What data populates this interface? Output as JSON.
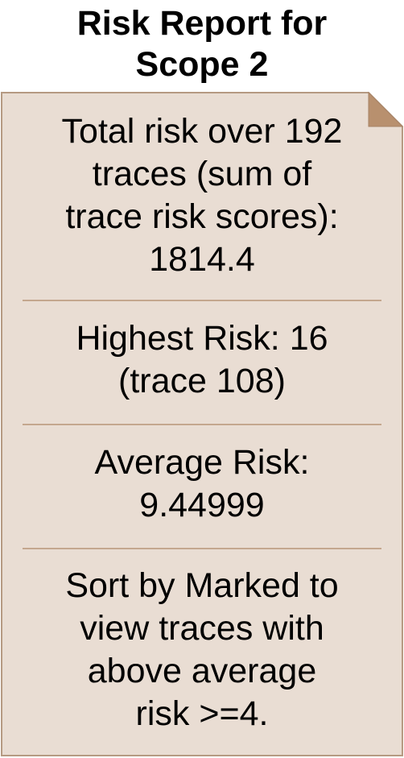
{
  "title": {
    "line1": "Risk Report for",
    "line2": "Scope 2"
  },
  "report": {
    "total": {
      "line1": "Total risk over 192",
      "line2": "traces (sum of",
      "line3": "trace risk scores):",
      "line4": "1814.4"
    },
    "highest": {
      "line1": "Highest Risk: 16",
      "line2": "(trace 108)"
    },
    "average": {
      "line1": "Average Risk:",
      "line2": "9.44999"
    },
    "sort_hint": {
      "line1": "Sort by Marked to",
      "line2": "view traces with",
      "line3": "above average",
      "line4": "risk >=4."
    }
  },
  "colors": {
    "note_fill": "#e9ddd3",
    "note_stroke": "#b59a82",
    "fold_fill": "#b8906e",
    "divider": "#c4a78e"
  }
}
